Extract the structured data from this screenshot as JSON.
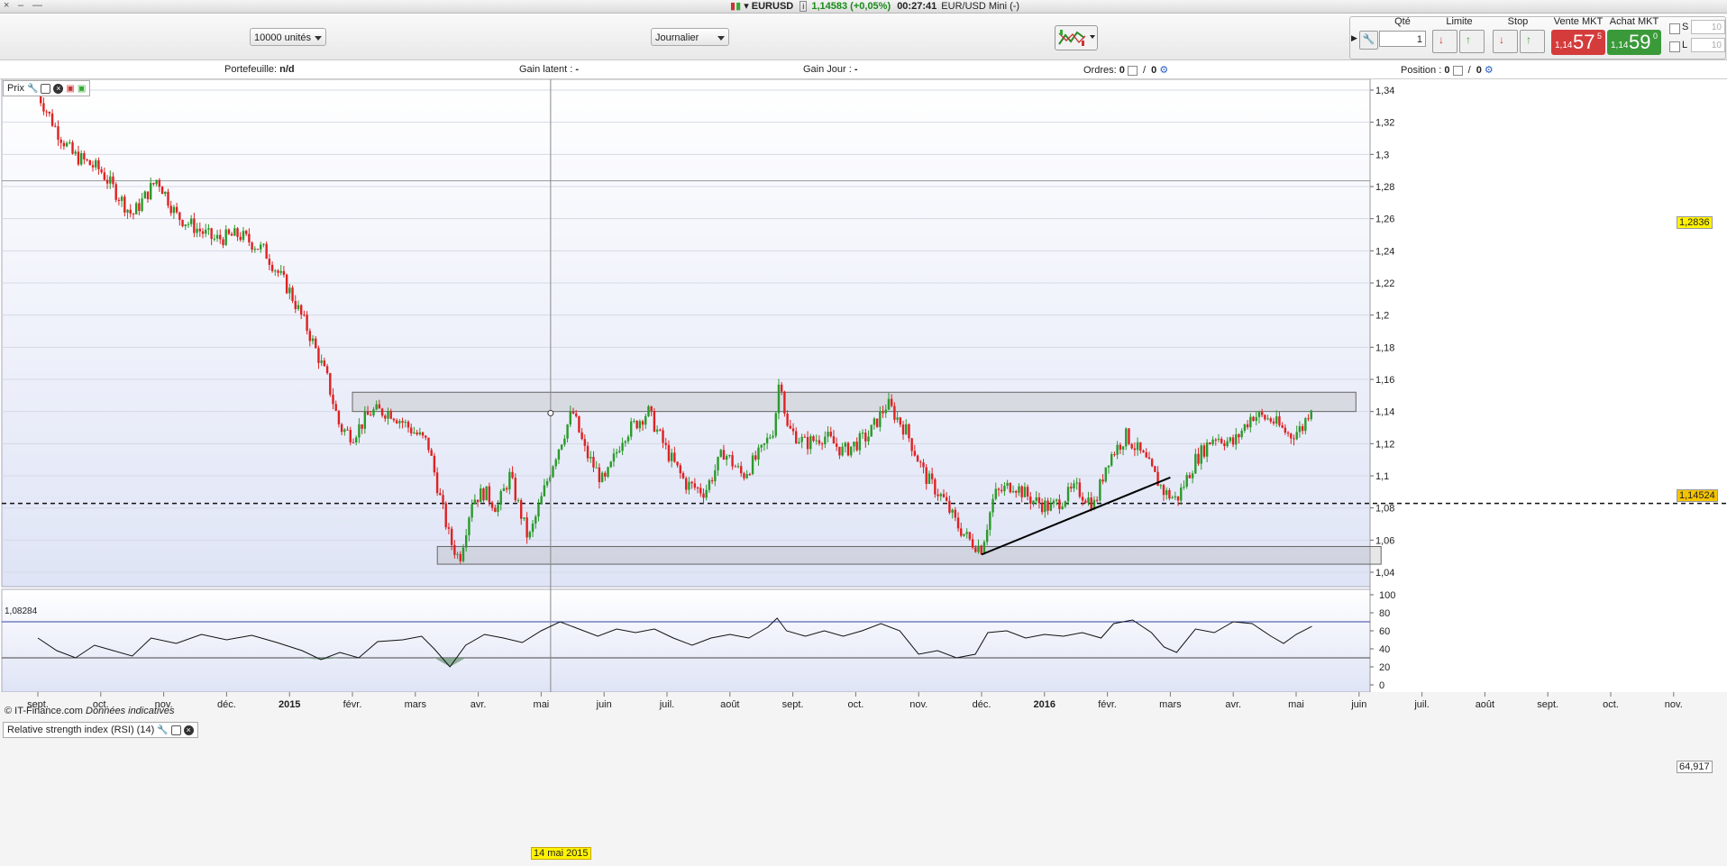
{
  "titlebar": {
    "symbol": "EURUSD",
    "info_icon": "i",
    "price_change": "1,14583 (+0,05%)",
    "time": "00:27:41",
    "instrument": "EUR/USD Mini (-)"
  },
  "toolbar": {
    "units_select": "10000 unités",
    "period_select": "Journalier"
  },
  "order_panel": {
    "qty_label": "Qté",
    "qty_value": "1",
    "limit_label": "Limite",
    "stop_label": "Stop",
    "sell_label": "Vente MKT",
    "sell_small": "1,14",
    "sell_big": "57",
    "sell_sup": "5",
    "buy_label": "Achat MKT",
    "buy_small": "1,14",
    "buy_big": "59",
    "buy_sup": "0",
    "s_label": "S",
    "s_value": "10",
    "l_label": "L",
    "l_value": "10",
    "sell_color": "#d43c3c",
    "buy_color": "#3a9a3a"
  },
  "info_row": {
    "portefeuille_label": "Portefeuille:",
    "portefeuille_value": "n/d",
    "gain_latent_label": "Gain latent :",
    "gain_latent_value": "-",
    "gain_jour_label": "Gain Jour :",
    "gain_jour_value": "-",
    "ordres_label": "Ordres:",
    "ordres_value1": "0",
    "ordres_sep": "/",
    "ordres_value2": "0",
    "position_label": "Position :",
    "position_value1": "0",
    "position_value2": "0"
  },
  "chart_panel": {
    "title": "Prix",
    "copyright": "© IT-Finance.com",
    "copyright_note": "Données indicatives",
    "rsi_title": "Relative strength index (RSI) (14)",
    "crosshair_date": "14 mai 2015",
    "hline_label": "1,08284",
    "price_tag_1": "1,2836",
    "price_tag_2": "1,14524",
    "rsi_tag": "64,917"
  },
  "chart_data": [
    {
      "type": "candlestick",
      "title": "Prix",
      "symbol": "EUR/USD",
      "ylim": [
        1.035,
        1.345
      ],
      "yticks": [
        "1,34",
        "1,32",
        "1,3",
        "1,28",
        "1,26",
        "1,24",
        "1,22",
        "1,2",
        "1,18",
        "1,16",
        "1,14",
        "1,12",
        "1,1",
        "1,08",
        "1,06",
        "1,04"
      ],
      "ytick_values": [
        1.34,
        1.32,
        1.3,
        1.28,
        1.26,
        1.24,
        1.22,
        1.2,
        1.18,
        1.16,
        1.14,
        1.12,
        1.1,
        1.08,
        1.06,
        1.04
      ],
      "x_months": [
        "sept.",
        "oct.",
        "nov.",
        "déc.",
        "2015",
        "févr.",
        "mars",
        "avr.",
        "mai",
        "juin",
        "juil.",
        "août",
        "sept.",
        "oct.",
        "nov.",
        "déc.",
        "2016",
        "févr.",
        "mars",
        "avr.",
        "mai",
        "juin",
        "juil.",
        "août",
        "sept.",
        "oct.",
        "nov."
      ],
      "x_month_index": [
        0,
        1,
        2,
        3,
        4,
        5,
        6,
        7,
        8,
        9,
        10,
        11,
        12,
        13,
        14,
        15,
        16,
        17,
        18,
        19,
        20,
        21,
        22,
        23,
        24,
        25,
        26
      ],
      "close_path": [
        [
          0,
          1.338
        ],
        [
          0.3,
          1.315
        ],
        [
          0.55,
          1.3
        ],
        [
          1.0,
          1.29
        ],
        [
          1.5,
          1.262
        ],
        [
          1.9,
          1.285
        ],
        [
          2.2,
          1.262
        ],
        [
          2.8,
          1.247
        ],
        [
          3.2,
          1.25
        ],
        [
          3.6,
          1.24
        ],
        [
          4.0,
          1.215
        ],
        [
          4.3,
          1.19
        ],
        [
          4.6,
          1.16
        ],
        [
          4.8,
          1.13
        ],
        [
          5.0,
          1.125
        ],
        [
          5.3,
          1.14
        ],
        [
          5.6,
          1.14
        ],
        [
          5.9,
          1.13
        ],
        [
          6.2,
          1.12
        ],
        [
          6.4,
          1.085
        ],
        [
          6.55,
          1.06
        ],
        [
          6.7,
          1.048
        ],
        [
          6.9,
          1.085
        ],
        [
          7.1,
          1.09
        ],
        [
          7.3,
          1.08
        ],
        [
          7.5,
          1.1
        ],
        [
          7.8,
          1.06
        ],
        [
          8.0,
          1.085
        ],
        [
          8.2,
          1.11
        ],
        [
          8.5,
          1.14
        ],
        [
          8.7,
          1.115
        ],
        [
          9.0,
          1.095
        ],
        [
          9.3,
          1.125
        ],
        [
          9.7,
          1.14
        ],
        [
          10.0,
          1.115
        ],
        [
          10.3,
          1.095
        ],
        [
          10.6,
          1.09
        ],
        [
          10.9,
          1.115
        ],
        [
          11.2,
          1.1
        ],
        [
          11.5,
          1.115
        ],
        [
          11.7,
          1.13
        ],
        [
          11.8,
          1.165
        ],
        [
          11.9,
          1.13
        ],
        [
          12.2,
          1.12
        ],
        [
          12.5,
          1.125
        ],
        [
          12.8,
          1.115
        ],
        [
          13.2,
          1.125
        ],
        [
          13.5,
          1.145
        ],
        [
          13.8,
          1.128
        ],
        [
          14.1,
          1.1
        ],
        [
          14.4,
          1.085
        ],
        [
          14.6,
          1.07
        ],
        [
          14.8,
          1.06
        ],
        [
          15.0,
          1.055
        ],
        [
          15.2,
          1.088
        ],
        [
          15.5,
          1.095
        ],
        [
          15.8,
          1.085
        ],
        [
          16.1,
          1.08
        ],
        [
          16.5,
          1.092
        ],
        [
          16.8,
          1.082
        ],
        [
          17.0,
          1.11
        ],
        [
          17.3,
          1.125
        ],
        [
          17.6,
          1.11
        ],
        [
          17.9,
          1.09
        ],
        [
          18.1,
          1.085
        ],
        [
          18.4,
          1.11
        ],
        [
          18.7,
          1.125
        ],
        [
          19.0,
          1.12
        ],
        [
          19.3,
          1.138
        ],
        [
          19.6,
          1.135
        ],
        [
          19.9,
          1.125
        ],
        [
          20.1,
          1.13
        ],
        [
          20.25,
          1.145
        ]
      ],
      "zones": [
        {
          "x": [
            5.0,
            20.95
          ],
          "y": [
            1.14,
            1.152
          ]
        },
        {
          "x": [
            6.35,
            21.35
          ],
          "y": [
            1.045,
            1.056
          ]
        }
      ],
      "trendline": [
        [
          15.0,
          1.051
        ],
        [
          18.0,
          1.099
        ]
      ],
      "hlines": [
        {
          "y": 1.08284,
          "style": "dashed"
        }
      ],
      "last_price": 1.14524,
      "marked_price": 1.2836
    },
    {
      "type": "line",
      "title": "Relative strength index (RSI) (14)",
      "ylim": [
        0,
        100
      ],
      "yticks": [
        "100",
        "80",
        "60",
        "40",
        "20",
        "0"
      ],
      "ytick_values": [
        100,
        80,
        60,
        40,
        20,
        0
      ],
      "bands": [
        30,
        70
      ],
      "path": [
        [
          0,
          52
        ],
        [
          0.3,
          38
        ],
        [
          0.6,
          30
        ],
        [
          0.9,
          44
        ],
        [
          1.2,
          38
        ],
        [
          1.5,
          32
        ],
        [
          1.8,
          52
        ],
        [
          2.2,
          46
        ],
        [
          2.6,
          56
        ],
        [
          3.0,
          50
        ],
        [
          3.4,
          55
        ],
        [
          3.8,
          47
        ],
        [
          4.2,
          38
        ],
        [
          4.5,
          28
        ],
        [
          4.8,
          36
        ],
        [
          5.1,
          30
        ],
        [
          5.4,
          48
        ],
        [
          5.8,
          50
        ],
        [
          6.1,
          54
        ],
        [
          6.3,
          40
        ],
        [
          6.55,
          20
        ],
        [
          6.8,
          44
        ],
        [
          7.1,
          56
        ],
        [
          7.4,
          52
        ],
        [
          7.7,
          47
        ],
        [
          8.0,
          60
        ],
        [
          8.3,
          70
        ],
        [
          8.6,
          62
        ],
        [
          8.9,
          54
        ],
        [
          9.2,
          62
        ],
        [
          9.5,
          58
        ],
        [
          9.8,
          62
        ],
        [
          10.1,
          52
        ],
        [
          10.4,
          44
        ],
        [
          10.7,
          52
        ],
        [
          11.0,
          56
        ],
        [
          11.3,
          52
        ],
        [
          11.6,
          64
        ],
        [
          11.75,
          74
        ],
        [
          11.9,
          60
        ],
        [
          12.2,
          54
        ],
        [
          12.5,
          60
        ],
        [
          12.8,
          54
        ],
        [
          13.1,
          60
        ],
        [
          13.4,
          68
        ],
        [
          13.7,
          60
        ],
        [
          14.0,
          34
        ],
        [
          14.3,
          38
        ],
        [
          14.6,
          30
        ],
        [
          14.9,
          34
        ],
        [
          15.1,
          58
        ],
        [
          15.4,
          60
        ],
        [
          15.7,
          52
        ],
        [
          16.0,
          56
        ],
        [
          16.3,
          54
        ],
        [
          16.6,
          58
        ],
        [
          16.9,
          52
        ],
        [
          17.1,
          68
        ],
        [
          17.4,
          72
        ],
        [
          17.7,
          58
        ],
        [
          17.9,
          42
        ],
        [
          18.1,
          36
        ],
        [
          18.4,
          62
        ],
        [
          18.7,
          58
        ],
        [
          19.0,
          70
        ],
        [
          19.3,
          68
        ],
        [
          19.6,
          54
        ],
        [
          19.8,
          46
        ],
        [
          20.0,
          56
        ],
        [
          20.25,
          64.9
        ]
      ],
      "last_value": 64.917
    }
  ]
}
